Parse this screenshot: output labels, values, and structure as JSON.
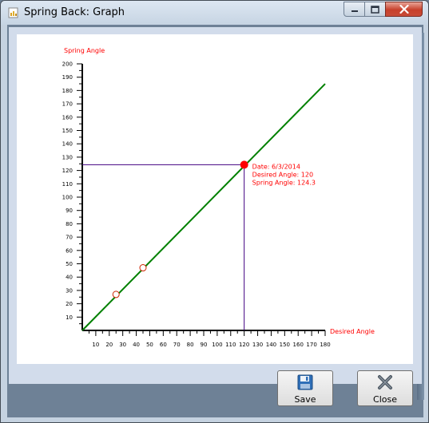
{
  "window": {
    "title": "Spring Back: Graph",
    "app_icon": "document-chart-icon",
    "controls": [
      "minimize-icon",
      "maximize-icon",
      "close-icon"
    ]
  },
  "buttons": {
    "save_label": "Save",
    "save_icon": "floppy-disk-icon",
    "close_label": "Close",
    "close_icon": "x-close-icon"
  },
  "colors": {
    "axis_label": "#ff0000",
    "line": "#008000",
    "crosshair": "#400080",
    "highlight_point": "#ff0000",
    "window_bg": "#6e8196"
  },
  "chart_data": {
    "type": "line",
    "xlabel": "Desired Angle",
    "ylabel": "Spring Angle",
    "xlim": [
      0,
      180
    ],
    "ylim": [
      0,
      200
    ],
    "x_ticks": [
      10,
      20,
      30,
      40,
      50,
      60,
      70,
      80,
      90,
      100,
      110,
      120,
      130,
      140,
      150,
      160,
      170,
      180
    ],
    "y_ticks": [
      10,
      20,
      30,
      40,
      50,
      60,
      70,
      80,
      90,
      100,
      110,
      120,
      130,
      140,
      150,
      160,
      170,
      180,
      190,
      200
    ],
    "series": [
      {
        "x": [
          0,
          180
        ],
        "y": [
          0,
          185
        ]
      }
    ],
    "points": [
      {
        "x": 25,
        "y": 27,
        "selected": false
      },
      {
        "x": 45,
        "y": 47,
        "selected": false
      },
      {
        "x": 120,
        "y": 124.3,
        "selected": true
      }
    ],
    "selected_info": {
      "date": "Date: 6/3/2014",
      "desired": "Desired Angle: 120",
      "spring": "Spring Angle: 124.3"
    }
  }
}
